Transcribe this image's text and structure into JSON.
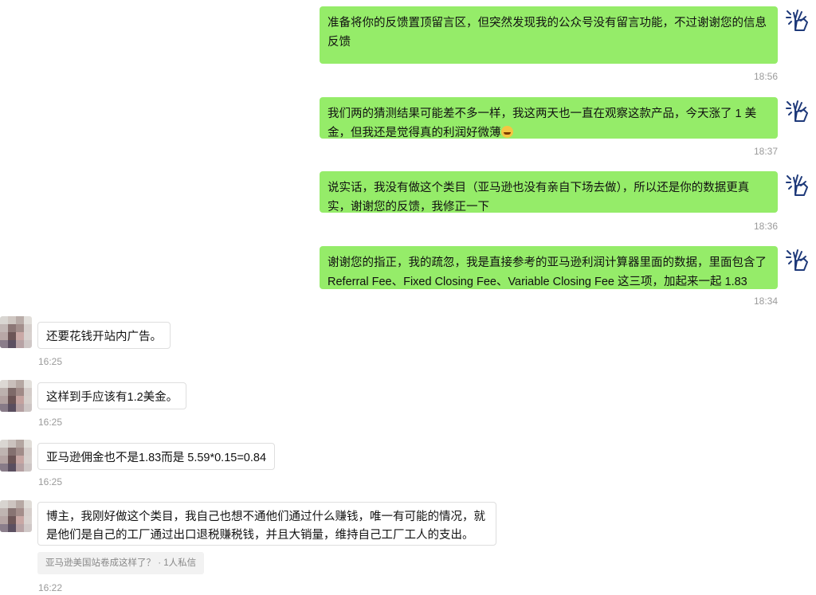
{
  "messages_right": [
    {
      "text": "准备将你的反馈置顶留言区，但突然发现我的公众号没有留言功能，不过谢谢您的信息反馈",
      "time": "18:56"
    },
    {
      "text": "我们两的猜测结果可能差不多一样，我这两天也一直在观察这款产品，今天涨了 1 美金，但我还是觉得真的利润好微薄",
      "time": "18:37",
      "emoji": "laugh-cry-emoji"
    },
    {
      "text": "说实话，我没有做这个类目（亚马逊也没有亲自下场去做），所以还是你的数据更真实，谢谢您的反馈，我修正一下",
      "time": "18:36"
    },
    {
      "text": "谢谢您的指正，我的疏忽，我是直接参考的亚马逊利润计算器里面的数据，里面包含了 Referral Fee、Fixed Closing Fee、Variable Closing Fee 这三项，加起来一起 1.83",
      "time": "18:34"
    }
  ],
  "messages_left": [
    {
      "text": "还要花钱开站内广告。",
      "time": "16:25"
    },
    {
      "text": "这样到手应该有1.2美金。",
      "time": "16:25"
    },
    {
      "text": "亚马逊佣金也不是1.83而是 5.59*0.15=0.84",
      "time": "16:25"
    },
    {
      "text": "博主，我刚好做这个类目，我自己也想不通他们通过什么赚钱，唯一有可能的情况，就是他们是自己的工厂通过出口退税赚税钱，并且大销量，维持自己工厂工人的支出。",
      "time": "16:22",
      "quote": "亚马逊美国站卷成这样了？ · 1人私信"
    }
  ],
  "icons": {
    "author_avatar": "hand-sign-avatar-icon",
    "user_avatar": "pixelated-avatar"
  },
  "colors": {
    "right_bubble": "#95ec69",
    "left_bubble": "#ffffff",
    "timestamp": "#9a9a9a"
  }
}
